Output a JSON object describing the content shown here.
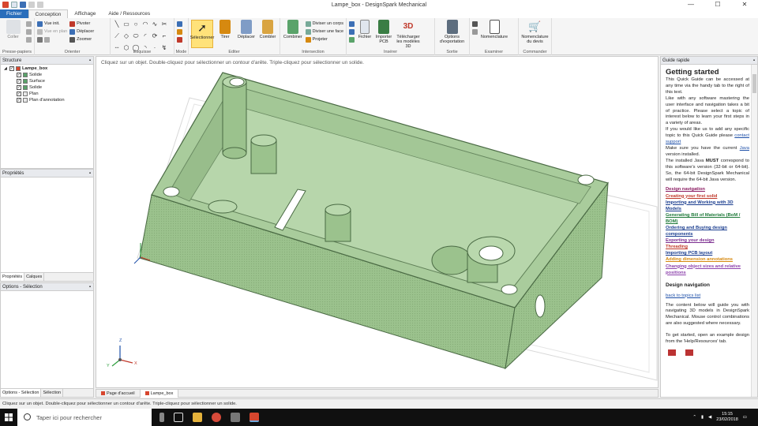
{
  "window": {
    "title": "Lampe_box - DesignSpark Mechanical"
  },
  "window_controls": {
    "minimize": "—",
    "maximize": "☐",
    "close": "✕"
  },
  "menu_tabs": [
    "Fichier",
    "Conception",
    "Affichage",
    "Aide / Ressources"
  ],
  "ribbon": {
    "presse_papiers": {
      "label": "Presse-papiers",
      "coller": "Coller"
    },
    "orienter": {
      "label": "Orienter",
      "items": [
        "Vue init.",
        "Vue en plan",
        "Pivoter",
        "Déplacer",
        "Zoomer"
      ]
    },
    "esquisse": {
      "label": "Esquisse"
    },
    "mode": {
      "label": "Mode"
    },
    "editer": {
      "label": "Editer",
      "selectionner": "Sélectionner",
      "tirer": "Tirer",
      "deplacer": "Déplacer",
      "combler": "Combler"
    },
    "intersection": {
      "label": "Intersection",
      "combiner": "Combiner",
      "items": [
        "Diviser un corps",
        "Diviser une face",
        "Projeter"
      ]
    },
    "inserer": {
      "label": "Insérer",
      "fichier": "Fichier",
      "importer_pcb": "Importer PCB",
      "telecharger": "Télécharger les modèles 3D"
    },
    "sortie": {
      "label": "Sortie",
      "options": "Options d'exportation"
    },
    "examiner": {
      "label": "Examiner",
      "nomenclature": "Nomenclature"
    },
    "commander": {
      "label": "Commander",
      "nomenclature_devis": "Nomenclature du devis"
    }
  },
  "structure": {
    "title": "Structure",
    "items": [
      {
        "label": "Lampe_box",
        "level": 0,
        "bold": true
      },
      {
        "label": "Solide",
        "level": 1
      },
      {
        "label": "Surface",
        "level": 1
      },
      {
        "label": "Solide",
        "level": 1
      },
      {
        "label": "Plan",
        "level": 1
      },
      {
        "label": "Plan d'annotation",
        "level": 1
      }
    ]
  },
  "properties": {
    "title": "Propriétés",
    "tabs": [
      "Propriétés",
      "Calques"
    ]
  },
  "options": {
    "title": "Options - Sélection",
    "tabs": [
      "Options - Sélection",
      "Sélection"
    ]
  },
  "viewport": {
    "hint": "Cliquez sur un objet. Double-cliquez pour sélectionner un contour d'arête. Triple-cliquez pour sélectionner un solide.",
    "axes": {
      "x": "X",
      "y": "Y",
      "z": "Z"
    }
  },
  "doc_tabs": [
    "Page d'accueil",
    "Lampe_box"
  ],
  "guide": {
    "title": "Guide rapide",
    "heading": "Getting started",
    "p1": "This Quick Guide can be accessed at any time via the handy tab to the right of this text.",
    "p2": "Like with any software mastering the user interface and navigation takes a bit of practice. Please select a topic of interest below to learn your first steps in a variety of areas.",
    "p3_a": "If you would like us to add any specific topic to this Quick Guide please ",
    "p3_link": "contact support",
    "p4_a": "Make sure you have the current ",
    "p4_link": "Java",
    "p4_b": " version installed.",
    "p5_a": "The installed Java ",
    "p5_bold": "MUST",
    "p5_b": " correspond to this software's version (32-bit or 64-bit). So, the 64-bit DesignSpark Mechanical will require the 64-bit Java version.",
    "links": [
      {
        "label": "Design navigation",
        "color": "#8b1c62"
      },
      {
        "label": "Creating your first solid",
        "color": "#c0392b"
      },
      {
        "label": "Importing and Working with 3D Models",
        "color": "#1a3d8f"
      },
      {
        "label": "Generating Bill of Materials (BoM / BOM)",
        "color": "#1f7a3a"
      },
      {
        "label": "Ordering and Buying design components",
        "color": "#1a3d8f"
      },
      {
        "label": "Exporting your design",
        "color": "#7b2d8f"
      },
      {
        "label": "Threading",
        "color": "#c0392b"
      },
      {
        "label": "Importing PCB layout",
        "color": "#1a3d8f"
      },
      {
        "label": "Adding dimension annotations",
        "color": "#d68910"
      },
      {
        "label": "Changing object sizes and relative positions",
        "color": "#8e44ad"
      }
    ],
    "section_title": "Design navigation",
    "back_link": "back to topics list",
    "p6": "The content below will guide you with navigating 3D models in DesignSpark Mechanical. Mouse control combinations are also suggested where necessary.",
    "p7": "To get started, open an example design from the 'Help/Resources' tab."
  },
  "status": {
    "text": "Cliquez sur un objet. Double-cliquez pour sélectionner un contour d'arête. Triple-cliquez pour sélectionner un solide."
  },
  "taskbar": {
    "search_placeholder": "Taper ici pour rechercher",
    "time": "15:15",
    "date": "23/02/2018"
  },
  "colors": {
    "accent": "#2a6ebb",
    "model_fill": "#a9cc9c",
    "model_stroke": "#4a6a44",
    "selected_btn": "#ffe27a"
  }
}
